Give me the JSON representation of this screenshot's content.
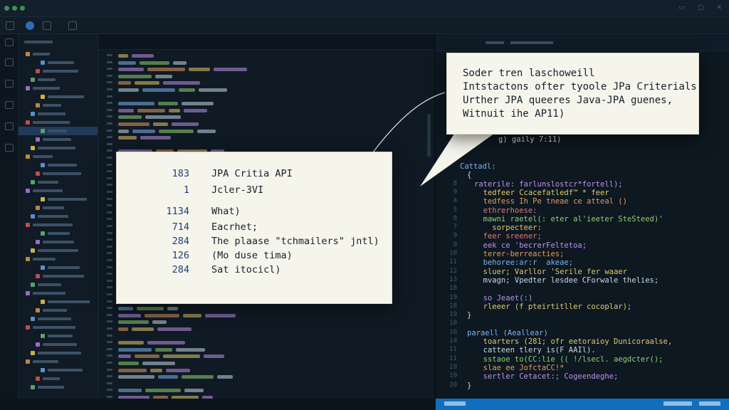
{
  "colors": {
    "background": "#0f1923",
    "card_bg": "#f6f5ec",
    "card_text": "#16202b",
    "card_number": "#1f3f7d",
    "selection": "#213a5a",
    "status_bar": "#0f6fbf",
    "kw_yellow": "#e3c86a",
    "kw_blue": "#7db3f0",
    "kw_purple": "#c092e8",
    "kw_green": "#8fd16e",
    "kw_orange": "#e59b5e",
    "kw_red": "#e07a7a",
    "text_plain": "#c9d6e2"
  },
  "callout_left": {
    "rows": [
      {
        "num": "183",
        "text": "JPA Critia API"
      },
      {
        "num": "1",
        "text": "Jcler-3VI"
      },
      {
        "num": "1134",
        "text": "What)"
      },
      {
        "num": "714",
        "text": "Eacrhet;"
      },
      {
        "num": "284",
        "text": "The plaase \"tchmailers\" jntl)"
      },
      {
        "num": "126",
        "text": "(Mo duse tima)"
      },
      {
        "num": "284",
        "text": "Sat itocicl)"
      }
    ]
  },
  "callout_right": {
    "lines": [
      "Soder tren laschoweill",
      "Intstactons ofter tyoole JPa Criterials",
      "Urther JPA queeres Java-JPA guenes,",
      "Witnuit ihe AP11)"
    ]
  },
  "right_editor": {
    "partial_line": "g) gaily 7:11)",
    "code_lines": [
      {
        "ln": "",
        "text": "Cattadl:",
        "color": "kw_blue",
        "indent": 0
      },
      {
        "ln": "",
        "text": "{",
        "color": "text_plain",
        "indent": 1
      },
      {
        "ln": "8",
        "text": "raterile: farlunslostcr*fortell);",
        "color": "kw_purple",
        "indent": 2
      },
      {
        "ln": "9",
        "text": "  tedfeer Ccacefatledf™ * feer",
        "color": "kw_yellow",
        "indent": 2
      },
      {
        "ln": "4",
        "text": "  tedfess Ih Pe tneae ce atteal ()",
        "color": "kw_orange",
        "indent": 2
      },
      {
        "ln": "5",
        "text": "  ethrerhoese:",
        "color": "kw_red",
        "indent": 2
      },
      {
        "ln": "8",
        "text": "  mawni raetel(: eter al'ieeter SteSteed)'",
        "color": "kw_green",
        "indent": 2
      },
      {
        "ln": "7",
        "text": "    sorpecteer:",
        "color": "kw_yellow",
        "indent": 2
      },
      {
        "ln": "9",
        "text": "  feer sreener;",
        "color": "kw_red",
        "indent": 2
      },
      {
        "ln": "9",
        "text": "  eek ce 'becrerFeltetoa;",
        "color": "kw_purple",
        "indent": 2
      },
      {
        "ln": "10",
        "text": "  terer-berreacties;",
        "color": "kw_orange",
        "indent": 2
      },
      {
        "ln": "11",
        "text": "  behoree:ar:r  akeae;",
        "color": "kw_blue",
        "indent": 2
      },
      {
        "ln": "12",
        "text": "  sluer; Varllor 'Serile fer waaer",
        "color": "kw_yellow",
        "indent": 2
      },
      {
        "ln": "13",
        "text": "  mvagn; Vpedter lesdee CForwale thelies;",
        "color": "text_plain",
        "indent": 2
      },
      {
        "ln": "18",
        "text": "",
        "color": "text_plain",
        "indent": 2
      },
      {
        "ln": "19",
        "text": "  so Jeaet(:)",
        "color": "kw_purple",
        "indent": 2
      },
      {
        "ln": "18",
        "text": "  rleeer (f pteirtitller cocoplar);",
        "color": "kw_yellow",
        "indent": 2
      },
      {
        "ln": "19",
        "text": "}",
        "color": "text_plain",
        "indent": 1
      },
      {
        "ln": "10",
        "text": "",
        "color": "text_plain",
        "indent": 0
      },
      {
        "ln": "10",
        "text": "paraell (Aeallear)",
        "color": "kw_blue",
        "indent": 1
      },
      {
        "ln": "14",
        "text": "  toarters (281; ofr eetoraioy Dunicoraalse,",
        "color": "kw_yellow",
        "indent": 2
      },
      {
        "ln": "11",
        "text": "  catteen tlery is(F AAIl).",
        "color": "text_plain",
        "indent": 2
      },
      {
        "ln": "11",
        "text": "  sstaoe to(CC:lie (( !/lsecl. aegdcter();",
        "color": "kw_green",
        "indent": 2
      },
      {
        "ln": "19",
        "text": "  slae ee JofctaCC!*",
        "color": "kw_orange",
        "indent": 2
      },
      {
        "ln": "19",
        "text": "  sertler Cetacet:; Cogeendeghe;",
        "color": "kw_purple",
        "indent": 2
      },
      {
        "ln": "20",
        "text": "}",
        "color": "text_plain",
        "indent": 1
      }
    ]
  }
}
